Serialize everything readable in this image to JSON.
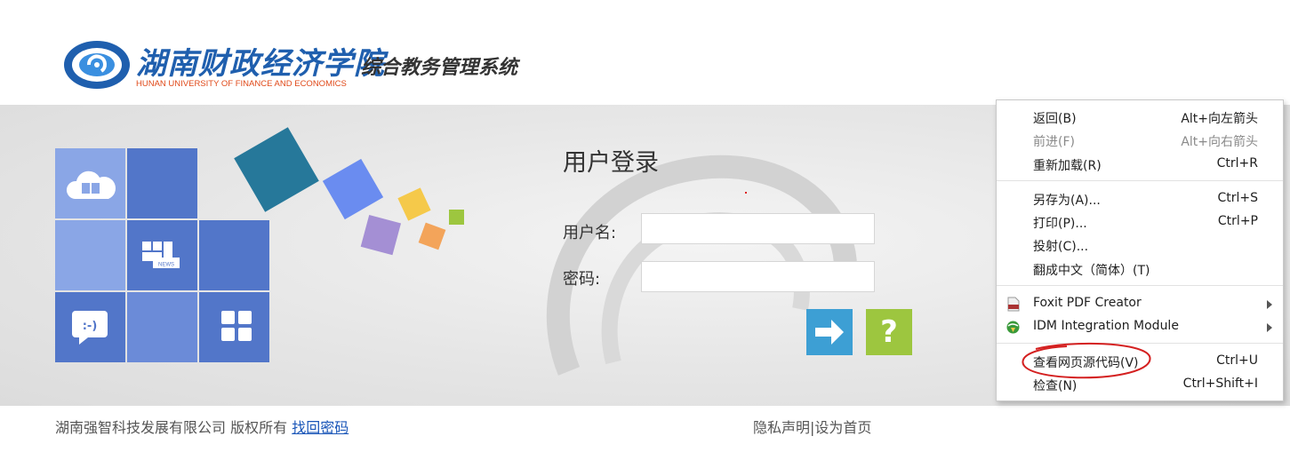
{
  "header": {
    "school_name_cn": "湖南财政经济学院",
    "school_name_en": "HUNAN UNIVERSITY OF FINANCE AND ECONOMICS",
    "system_title": "综合教务管理系统"
  },
  "login": {
    "title": "用户登录",
    "username_label": "用户名:",
    "username_value": "",
    "password_label": "密码:",
    "password_value": "",
    "help_label": "?"
  },
  "tiles": {
    "news_text": "NEWS",
    "chat_text": ":-)"
  },
  "footer": {
    "copyright": "湖南强智科技发展有限公司 版权所有",
    "find_password": "找回密码",
    "privacy": "隐私声明|设为首页"
  },
  "context_menu": {
    "items": [
      {
        "label": "返回(B)",
        "shortcut": "Alt+向左箭头"
      },
      {
        "label": "前进(F)",
        "shortcut": "Alt+向右箭头"
      },
      {
        "label": "重新加载(R)",
        "shortcut": "Ctrl+R"
      },
      {
        "label": "另存为(A)...",
        "shortcut": "Ctrl+S"
      },
      {
        "label": "打印(P)...",
        "shortcut": "Ctrl+P"
      },
      {
        "label": "投射(C)...",
        "shortcut": ""
      },
      {
        "label": "翻成中文（简体）(T)",
        "shortcut": ""
      },
      {
        "label": "Foxit PDF Creator",
        "shortcut": ""
      },
      {
        "label": "IDM Integration Module",
        "shortcut": ""
      },
      {
        "label": "查看网页源代码(V)",
        "shortcut": "Ctrl+U"
      },
      {
        "label": "检查(N)",
        "shortcut": "Ctrl+Shift+I"
      }
    ]
  },
  "colors": {
    "tile_dark": "#5276c9",
    "tile_light": "#8aa6e6",
    "tile_mid": "#6b8bd8",
    "go_button": "#3d9fd4",
    "help_button": "#9dc63f",
    "annotation_circle": "#d42020"
  }
}
